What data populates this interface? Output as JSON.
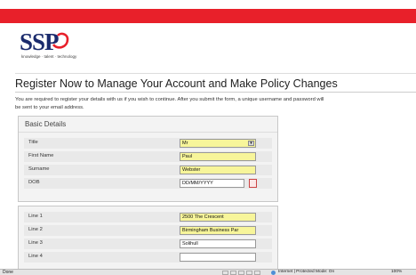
{
  "brand": {
    "logo_text": "SSP",
    "tagline": "knowledge · talent · technology",
    "red_color": "#e8202a",
    "navy_color": "#1a2a6c"
  },
  "page": {
    "title": "Register Now to Manage Your Account and Make Policy Changes",
    "intro": "You are required to register your details with us if you wish to continue. After you submit the form, a unique username and password will be sent to your email address."
  },
  "basic_details": {
    "heading": "Basic Details",
    "title_label": "Title",
    "title_value": "Mr",
    "first_name_label": "First Name",
    "first_name_value": "Paul",
    "surname_label": "Surname",
    "surname_value": "Webster",
    "dob_label": "DOB",
    "dob_value": "DD/MM/YYYY"
  },
  "address": {
    "line1_label": "Line 1",
    "line1_value": "2500 The Crescent",
    "line2_label": "Line 2",
    "line2_value": "Birmingham Business Par",
    "line3_label": "Line 3",
    "line3_value": "Solihull",
    "line4_label": "Line 4",
    "line4_value": ""
  },
  "statusbar": {
    "status": "Done",
    "zone": "Internet | Protected Mode: On",
    "zoom": "100%"
  }
}
